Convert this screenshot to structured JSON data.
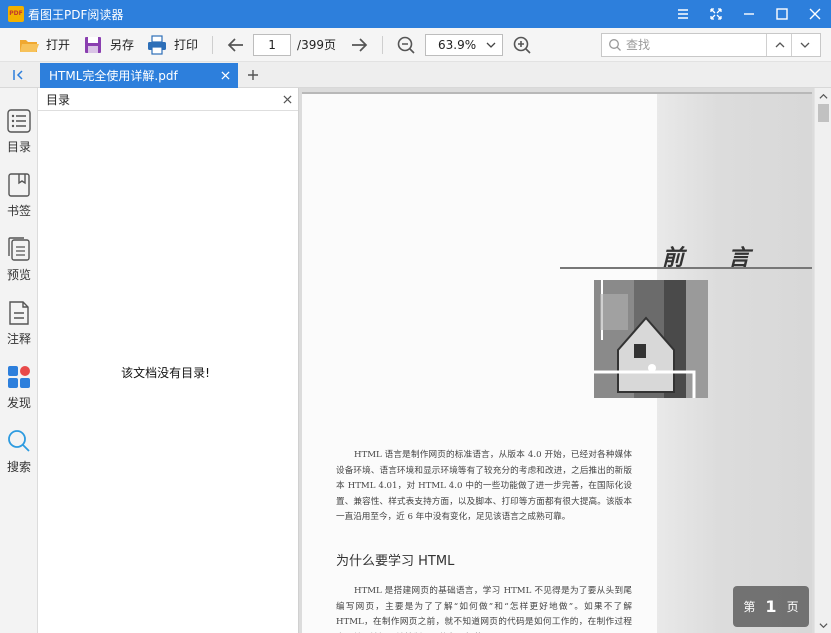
{
  "window": {
    "title": "看图王PDF阅读器",
    "logo_text": "PDF"
  },
  "toolbar": {
    "open_label": "打开",
    "saveas_label": "另存",
    "print_label": "打印",
    "page_current": "1",
    "page_total": "/399页",
    "zoom_value": "63.9%",
    "search_placeholder": "查找"
  },
  "tabs": [
    {
      "label": "HTML完全使用详解.pdf"
    }
  ],
  "rail": {
    "items": [
      {
        "label": "目录"
      },
      {
        "label": "书签"
      },
      {
        "label": "预览"
      },
      {
        "label": "注释"
      },
      {
        "label": "发现"
      },
      {
        "label": "搜索"
      }
    ]
  },
  "toc": {
    "title": "目录",
    "empty_message": "该文档没有目录!"
  },
  "document": {
    "preface_title": "前言",
    "para1": "HTML 语言是制作网页的标准语言，从版本 4.0 开始，已经对各种媒体设备环境、语言环境和显示环境等有了较充分的考虑和改进，之后推出的新版本 HTML 4.01，对 HTML 4.0 中的一些功能做了进一步完善，在国际化设置、兼容性、样式表支持方面，以及脚本、打印等方面都有很大提高。该版本一直沿用至今，近 6 年中没有变化，足见该语言之成熟可靠。",
    "section_heading": "为什么要学习 HTML",
    "para2": "HTML 是搭建网页的基础语言，学习 HTML 不见得是为了要从头到尾编写网页，主要是为了了解“如何做”和“怎样更好地做”。如果不了解 HTML，在制作网页之前，就不知道网页的代码是如何工作的，在制作过程中，就无法深入地控制网页的各项细节。"
  },
  "page_badge": {
    "prefix": "第",
    "number": "1",
    "suffix": "页"
  },
  "colors": {
    "accent": "#2d7fdc",
    "discover_red": "#e84a4a",
    "icon_blue": "#2d7fdc"
  }
}
